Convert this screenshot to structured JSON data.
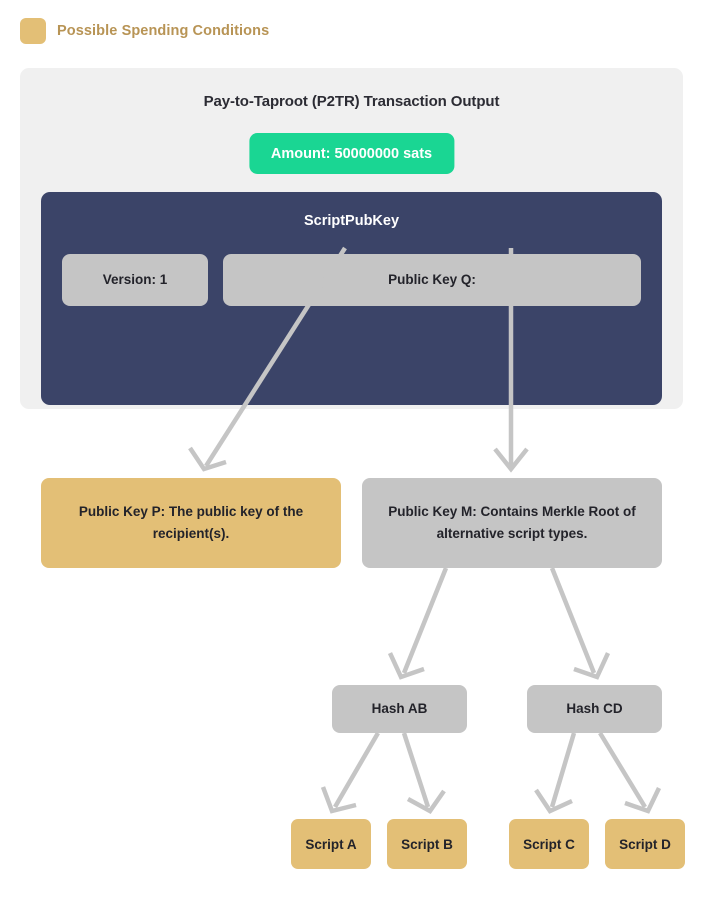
{
  "legend": {
    "swatch_color": "#e3bf76",
    "label": "Possible Spending Conditions"
  },
  "transaction": {
    "title": "Pay-to-Taproot (P2TR) Transaction Output",
    "amount_label": "Amount: 50000000 sats",
    "amount_color": "#1ad693",
    "card_color": "#f0f0f0"
  },
  "script_pub_key": {
    "title": "ScriptPubKey",
    "panel_color": "#3b4468",
    "version_label": "Version: 1",
    "public_key_q_label": "Public Key Q:"
  },
  "spending_paths": {
    "key_path": {
      "label": "Public Key P: The public key of the recipient(s).",
      "color": "#e3bf76"
    },
    "script_path": {
      "label": "Public Key M: Contains Merkle Root of alternative script types.",
      "color": "#c5c5c5"
    }
  },
  "merkle_tree": {
    "hashes": [
      {
        "label": "Hash AB"
      },
      {
        "label": "Hash CD"
      }
    ],
    "scripts": [
      {
        "label": "Script A"
      },
      {
        "label": "Script B"
      },
      {
        "label": "Script C"
      },
      {
        "label": "Script D"
      }
    ],
    "node_color": "#c5c5c5",
    "leaf_color": "#e3bf76"
  },
  "arrow_color": "#c5c5c5"
}
